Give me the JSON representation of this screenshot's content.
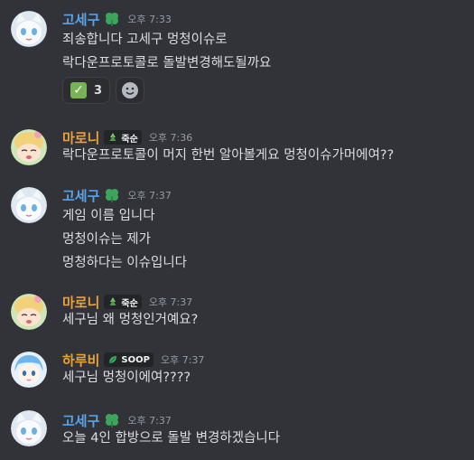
{
  "messages": [
    {
      "username": "고세구",
      "time": "오후 7:33",
      "badge_icon": "clover-icon",
      "lines": [
        "죄송합니다 고세구 멍청이슈로",
        "락다운프로토콜로 돌발변경해도될까요"
      ],
      "reactions": [
        {
          "emoji": "check-mark-icon",
          "count": "3"
        }
      ],
      "add_reaction_icon": "smiley-face-icon"
    },
    {
      "username": "마로니",
      "time": "오후 7:36",
      "tag_label": "죽순",
      "tag_icon": "bamboo-shoot-icon",
      "lines": [
        "락다운프로토콜이 머지 한번 알아볼게요 멍청이슈가머에여??"
      ]
    },
    {
      "username": "고세구",
      "time": "오후 7:37",
      "badge_icon": "clover-icon",
      "lines": [
        "게임 이름 입니다",
        "멍청이슈는 제가",
        "멍청하다는 이슈입니다"
      ]
    },
    {
      "username": "마로니",
      "time": "오후 7:37",
      "tag_label": "죽순",
      "tag_icon": "bamboo-shoot-icon",
      "lines": [
        "세구님 왜 멍청인거예요?"
      ]
    },
    {
      "username": "하루비",
      "time": "오후 7:37",
      "tag_label": "SOOP",
      "tag_icon": "leaf-icon",
      "lines": [
        "세구님 멍청이에여????"
      ]
    },
    {
      "username": "고세구",
      "time": "오후 7:37",
      "badge_icon": "clover-icon",
      "lines": [
        "오늘 4인 합방으로 돌발 변경하겠습니다"
      ]
    }
  ],
  "colors": {
    "background": "#313338",
    "username_gosegu": "#5ba3e8",
    "username_orange": "#e8a23a",
    "timestamp": "#949ba4",
    "text": "#dbdee1"
  }
}
